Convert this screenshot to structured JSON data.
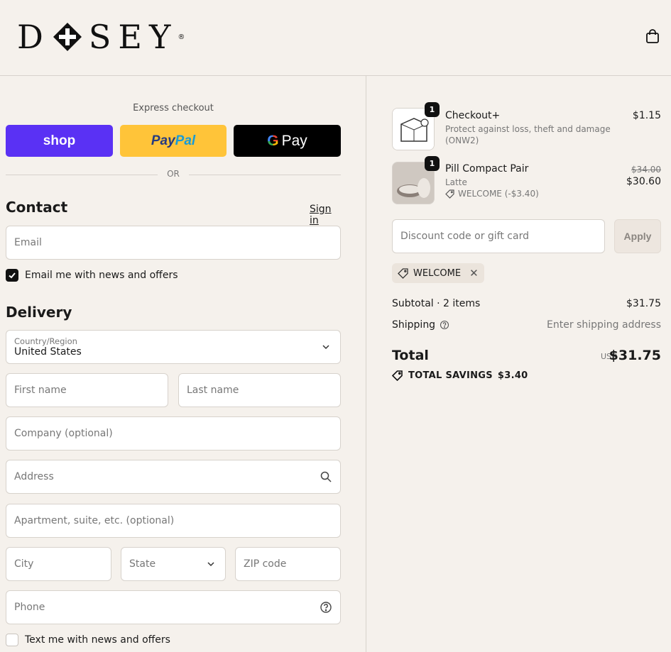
{
  "brand": {
    "logo_left": "D",
    "logo_right": "SEY",
    "reg": "®"
  },
  "express": {
    "title": "Express checkout",
    "shop": "shop",
    "paypal_a": "Pay",
    "paypal_b": "Pal",
    "gpay_g": "G",
    "gpay": "Pay",
    "or": "OR"
  },
  "contact": {
    "title": "Contact",
    "signin": "Sign in",
    "email_placeholder": "Email",
    "news_label": "Email me with news and offers",
    "news_checked": true
  },
  "delivery": {
    "title": "Delivery",
    "country_label": "Country/Region",
    "country_value": "United States",
    "first_name": "First name",
    "last_name": "Last name",
    "company": "Company (optional)",
    "address": "Address",
    "apartment": "Apartment, suite, etc. (optional)",
    "city": "City",
    "state": "State",
    "zip": "ZIP code",
    "phone": "Phone",
    "text_label": "Text me with news and offers",
    "text_checked": false
  },
  "cart": {
    "items": [
      {
        "qty": "1",
        "name": "Checkout+",
        "line1": "Protect against loss, theft and damage",
        "line2": "(ONW2)",
        "price": "$1.15"
      },
      {
        "qty": "1",
        "name": "Pill Compact Pair",
        "variant": "Latte",
        "discount": "WELCOME (-$3.40)",
        "old_price": "$34.00",
        "price": "$30.60"
      }
    ],
    "discount_placeholder": "Discount code or gift card",
    "apply": "Apply",
    "applied_code": "WELCOME",
    "subtotal_label": "Subtotal · 2 items",
    "subtotal": "$31.75",
    "shipping_label": "Shipping",
    "shipping": "Enter shipping address",
    "total_label": "Total",
    "currency": "USD",
    "total": "$31.75",
    "savings_label": "TOTAL SAVINGS",
    "savings": "$3.40"
  },
  "colors": {
    "background": "#f5f1ec",
    "shop": "#5a31f4",
    "paypal": "#ffc439",
    "gpay": "#000000",
    "border": "#d7d2cc"
  },
  "icons": [
    "cross-logo-icon",
    "shopping-bag-icon",
    "search-icon",
    "help-circle-icon",
    "chevron-down-icon",
    "checkmark-icon",
    "tag-icon",
    "close-icon",
    "info-icon"
  ]
}
